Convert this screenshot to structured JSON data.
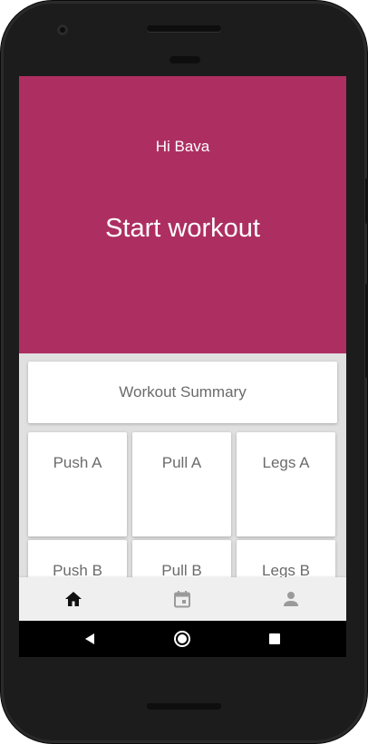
{
  "header": {
    "greeting": "Hi Bava",
    "start_label": "Start workout",
    "color": "#ad2f62"
  },
  "summary": {
    "label": "Workout Summary"
  },
  "workouts": [
    {
      "label": "Push A"
    },
    {
      "label": "Pull A"
    },
    {
      "label": "Legs A"
    },
    {
      "label": "Push B"
    },
    {
      "label": "Pull B"
    },
    {
      "label": "Legs B"
    }
  ],
  "bottom_nav": {
    "items": [
      {
        "icon": "home-icon",
        "active": true
      },
      {
        "icon": "calendar-icon",
        "active": false
      },
      {
        "icon": "person-icon",
        "active": false
      }
    ]
  },
  "system_nav": {
    "items": [
      {
        "icon": "back-triangle-icon"
      },
      {
        "icon": "home-circle-icon"
      },
      {
        "icon": "recents-square-icon"
      }
    ]
  }
}
